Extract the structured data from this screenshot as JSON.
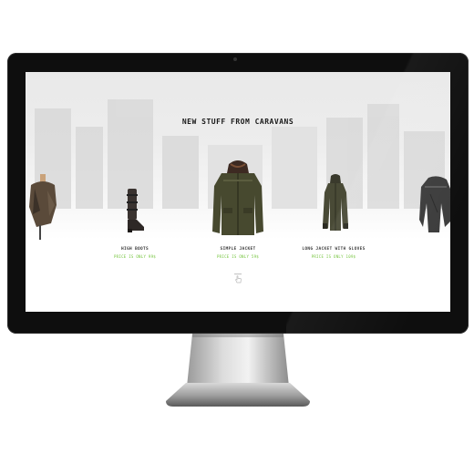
{
  "page": {
    "title": "NEW STUFF FROM CARAVANS"
  },
  "products": [
    {
      "name": "",
      "price": "",
      "icon": "poncho-figure-icon"
    },
    {
      "name": "HIGH BOOTS",
      "price": "PRICE IS ONLY 99$",
      "icon": "boot-icon"
    },
    {
      "name": "SIMPLE JACKET",
      "price": "PRICE IS ONLY 59$",
      "icon": "jacket-icon"
    },
    {
      "name": "LONG JACKET WITH GLOVES",
      "price": "PRICE IS ONLY 109$",
      "icon": "long-jacket-icon"
    },
    {
      "name": "",
      "price": "",
      "icon": "cape-icon"
    }
  ],
  "colors": {
    "accent": "#73c43b",
    "bezel": "#0e0e0e",
    "text": "#1b1b1b"
  },
  "hint": {
    "icon": "hand-pointer-icon"
  }
}
